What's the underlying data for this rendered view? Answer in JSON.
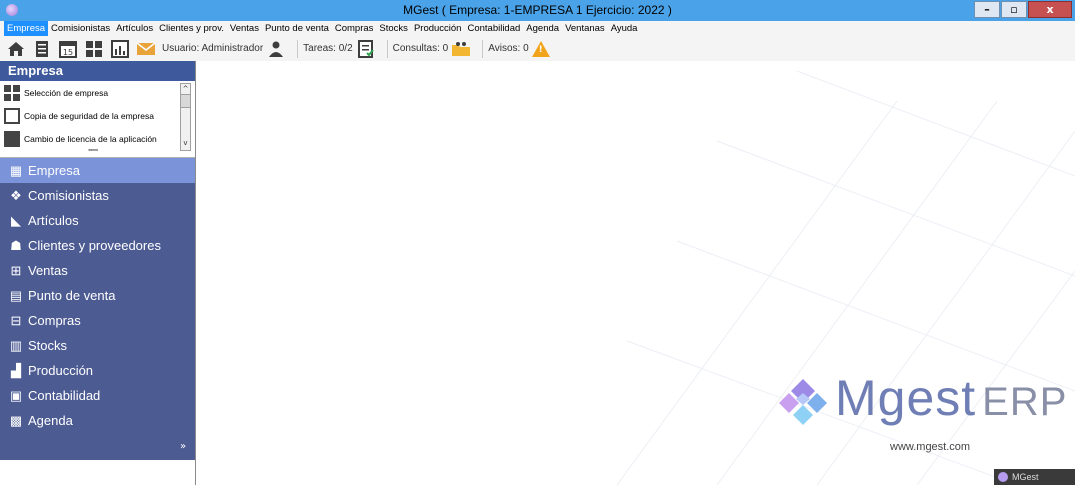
{
  "window": {
    "title": "MGest ( Empresa: 1-EMPRESA 1 Ejercicio: 2022 )",
    "controls": [
      "–",
      "▫",
      "x"
    ]
  },
  "menu": [
    "Empresa",
    "Comisionistas",
    "Artículos",
    "Clientes y prov.",
    "Ventas",
    "Punto de venta",
    "Compras",
    "Stocks",
    "Producción",
    "Contabilidad",
    "Agenda",
    "Ventanas",
    "Ayuda"
  ],
  "toolbar": {
    "user_label": "Usuario: Administrador",
    "tasks_label": "Tareas: 0/2",
    "queries_label": "Consultas: 0",
    "notices_label": "Avisos: 0"
  },
  "panel": {
    "header": "Empresa",
    "subitems": [
      {
        "label": "Selección de empresa",
        "icon": "company-grid-icon"
      },
      {
        "label": "Copia de seguridad de la empresa",
        "icon": "save-disk-icon"
      },
      {
        "label": "Cambio de licencia de la aplicación",
        "icon": "license-doc-icon"
      }
    ],
    "nav": [
      {
        "label": "Empresa",
        "icon": "building-icon",
        "active": true
      },
      {
        "label": "Comisionistas",
        "icon": "handshake-icon"
      },
      {
        "label": "Artículos",
        "icon": "tag-icon"
      },
      {
        "label": "Clientes y proveedores",
        "icon": "people-icon"
      },
      {
        "label": "Ventas",
        "icon": "cart-icon"
      },
      {
        "label": "Punto de venta",
        "icon": "pos-icon"
      },
      {
        "label": "Compras",
        "icon": "purchase-cart-icon"
      },
      {
        "label": "Stocks",
        "icon": "boxes-icon"
      },
      {
        "label": "Producción",
        "icon": "factory-icon"
      },
      {
        "label": "Contabilidad",
        "icon": "ledger-icon"
      },
      {
        "label": "Agenda",
        "icon": "calendar-icon"
      }
    ]
  },
  "branding": {
    "logo_text": "Mgest",
    "logo_suffix": "ERP",
    "url": "www.mgest.com",
    "task_chip": "MGest"
  },
  "colors": {
    "titlebar": "#4aa3e8",
    "panel_header": "#3f5a9c",
    "nav_bg": "#4d5b93",
    "nav_active": "#7b93d9",
    "menu_active": "#1e90ff"
  }
}
